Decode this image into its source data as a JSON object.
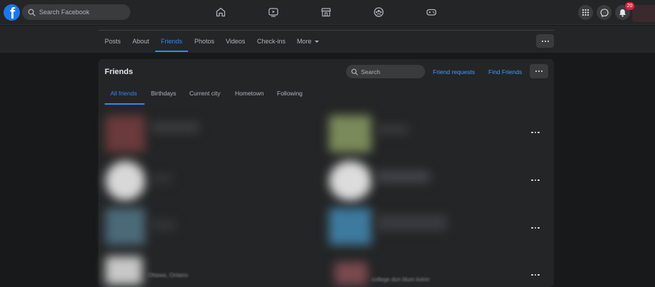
{
  "topbar": {
    "search_placeholder": "Search Facebook",
    "notification_count": "20",
    "logo_letter": "f"
  },
  "profile_tabs": [
    {
      "label": "Posts"
    },
    {
      "label": "About"
    },
    {
      "label": "Friends"
    },
    {
      "label": "Photos"
    },
    {
      "label": "Videos"
    },
    {
      "label": "Check-ins"
    },
    {
      "label": "More"
    }
  ],
  "friends_card": {
    "title": "Friends",
    "search_placeholder": "Search",
    "friend_requests_label": "Friend requests",
    "find_friends_label": "Find Friends",
    "tabs": [
      {
        "label": "All friends"
      },
      {
        "label": "Birthdays"
      },
      {
        "label": "Current city"
      },
      {
        "label": "Hometown"
      },
      {
        "label": "Following"
      }
    ],
    "blurred_snippets": [
      "Ottawa, Ontario",
      "college dun blum kvinn"
    ]
  },
  "colors": {
    "accent": "#2d88ff",
    "link": "#4599ff",
    "background": "#18191a",
    "surface": "#242526",
    "badge": "#e41e3f"
  }
}
